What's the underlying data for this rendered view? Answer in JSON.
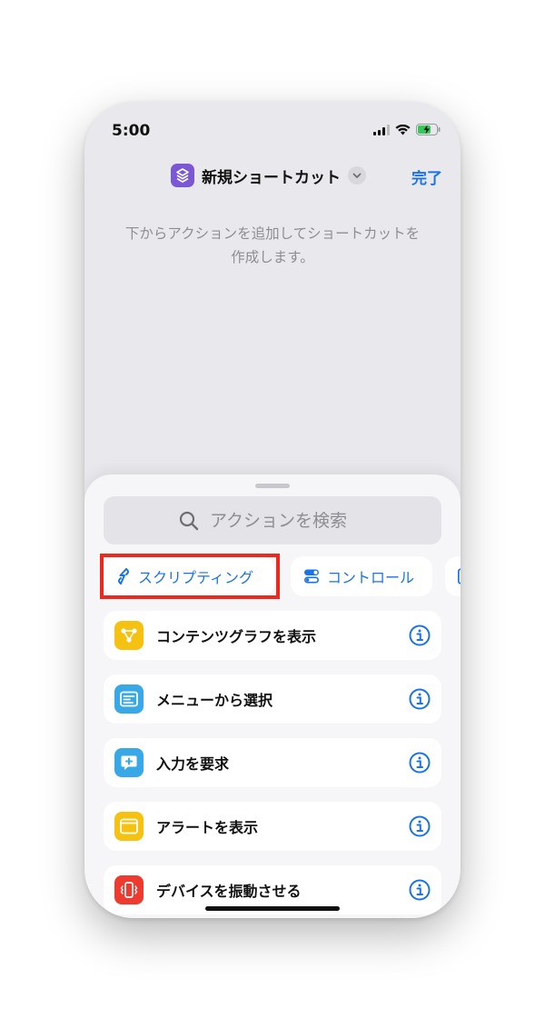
{
  "status": {
    "time": "5:00",
    "icons": [
      "cellular-signal-icon",
      "wifi-icon",
      "battery-charging-icon"
    ]
  },
  "nav": {
    "title": "新規ショートカット",
    "done_label": "完了",
    "app_icon": "shortcuts-icon"
  },
  "empty_hint": "下からアクションを追加してショートカットを作成します。",
  "search": {
    "placeholder": "アクションを検索"
  },
  "categories": [
    {
      "label": "スクリプティング",
      "icon": "scripting-icon",
      "highlighted": true
    },
    {
      "label": "コントロール",
      "icon": "toggle-control-icon",
      "highlighted": false
    },
    {
      "label": "",
      "icon": "device-icon",
      "highlighted": false
    }
  ],
  "actions": [
    {
      "label": "コンテンツグラフを表示",
      "icon": "graph-icon",
      "color": "#f5c211"
    },
    {
      "label": "メニューから選択",
      "icon": "menu-icon",
      "color": "#38a8e6"
    },
    {
      "label": "入力を要求",
      "icon": "input-icon",
      "color": "#38a8e6"
    },
    {
      "label": "アラートを表示",
      "icon": "alert-icon",
      "color": "#f5c211"
    },
    {
      "label": "デバイスを振動させる",
      "icon": "vibrate-icon",
      "color": "#ee3b2f"
    }
  ],
  "colors": {
    "accent": "#1a73e8",
    "highlight": "#ea2a1f",
    "app_icon": "#7b57d6"
  }
}
